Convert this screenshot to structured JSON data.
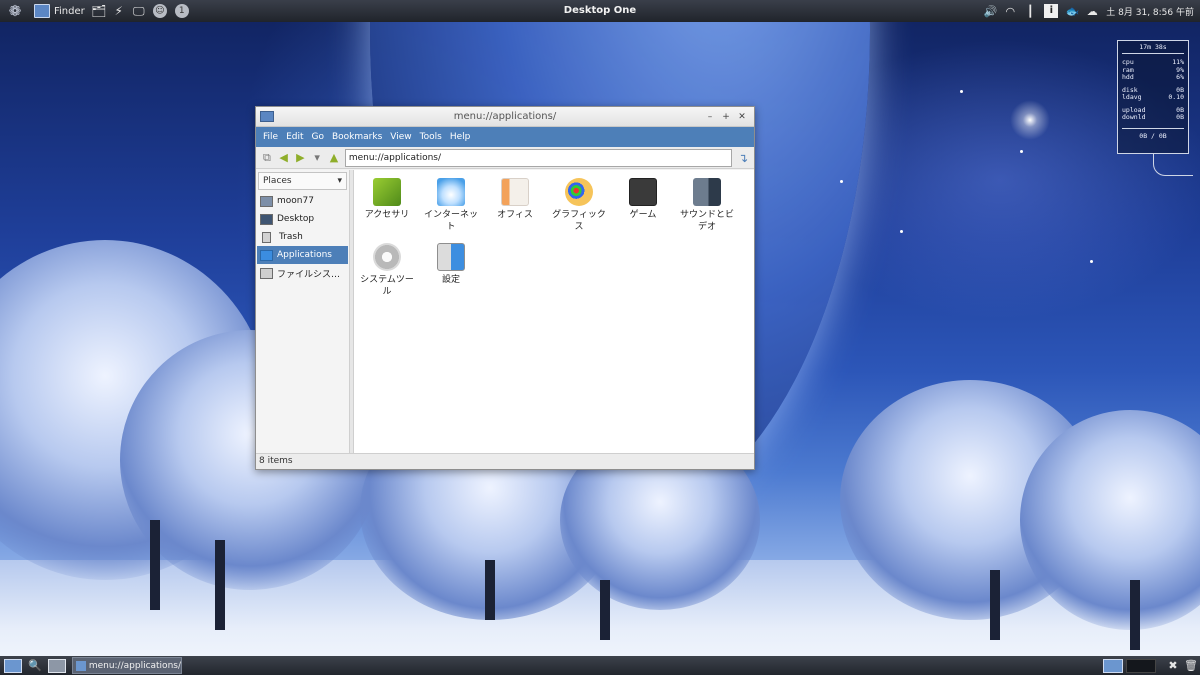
{
  "top_panel": {
    "finder_label": "Finder",
    "title": "Desktop One",
    "clock": "土  8月 31,  8:56 午前",
    "info_glyph": "i",
    "circle_icon_1": "☺",
    "circle_icon_2": "1"
  },
  "conky": {
    "uptime": "17m 38s",
    "stats": [
      {
        "label": "cpu",
        "value": "11%"
      },
      {
        "label": "ram",
        "value": "9%"
      },
      {
        "label": "hdd",
        "value": "6%"
      }
    ],
    "disk": [
      {
        "label": "disk",
        "value": "0B"
      },
      {
        "label": "ldavg",
        "value": "0.10"
      }
    ],
    "net": [
      {
        "label": "upload",
        "value": "0B"
      },
      {
        "label": "downld",
        "value": "0B"
      }
    ],
    "net_total": "0B  /  0B"
  },
  "window": {
    "title": "menu://applications/",
    "menu": [
      "File",
      "Edit",
      "Go",
      "Bookmarks",
      "View",
      "Tools",
      "Help"
    ],
    "location": "menu://applications/",
    "places_header": "Places",
    "places": [
      {
        "label": "moon77",
        "icon": "home-icon"
      },
      {
        "label": "Desktop",
        "icon": "desktop-icon"
      },
      {
        "label": "Trash",
        "icon": "trash-icon"
      },
      {
        "label": "Applications",
        "icon": "applications-icon"
      },
      {
        "label": "ファイルシス…",
        "icon": "filesystem-icon"
      }
    ],
    "apps": [
      {
        "label": "アクセサリ",
        "icon": "accessories-icon"
      },
      {
        "label": "インターネット",
        "icon": "internet-icon"
      },
      {
        "label": "オフィス",
        "icon": "office-icon"
      },
      {
        "label": "グラフィックス",
        "icon": "graphics-icon"
      },
      {
        "label": "ゲーム",
        "icon": "games-icon"
      },
      {
        "label": "サウンドとビデオ",
        "icon": "sound-video-icon"
      },
      {
        "label": "システムツール",
        "icon": "system-tools-icon"
      },
      {
        "label": "設定",
        "icon": "settings-icon"
      }
    ],
    "status": "8 items"
  },
  "bottom_panel": {
    "task_label": "menu://applications/"
  }
}
